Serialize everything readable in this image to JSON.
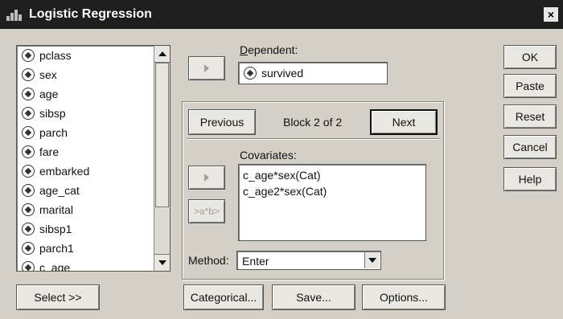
{
  "window": {
    "title": "Logistic Regression",
    "close_symbol": "×"
  },
  "variables": [
    {
      "name": "pclass"
    },
    {
      "name": "sex"
    },
    {
      "name": "age"
    },
    {
      "name": "sibsp"
    },
    {
      "name": "parch"
    },
    {
      "name": "fare"
    },
    {
      "name": "embarked"
    },
    {
      "name": "age_cat"
    },
    {
      "name": "marital"
    },
    {
      "name": "sibsp1"
    },
    {
      "name": "parch1"
    },
    {
      "name": "c_age"
    }
  ],
  "dependent": {
    "label": "Dependent:",
    "value": "survived"
  },
  "block": {
    "previous_label": "Previous",
    "status": "Block 2 of 2",
    "next_label": "Next"
  },
  "covariates": {
    "label": "Covariates:",
    "items": [
      "c_age*sex(Cat)",
      "c_age2*sex(Cat)"
    ]
  },
  "interaction_button": {
    "label": ">a*b>"
  },
  "method": {
    "label": "Method:",
    "value": "Enter"
  },
  "right_buttons": {
    "ok": "OK",
    "paste": "Paste",
    "reset": "Reset",
    "cancel": "Cancel",
    "help": "Help"
  },
  "bottom_buttons": {
    "select": "Select >>",
    "categorical": "Categorical...",
    "save": "Save...",
    "options": "Options..."
  },
  "colors": {
    "titlebar": "#1e1e1e",
    "face": "#d4d0c8"
  },
  "icons": {
    "variable": "scale-variable-icon",
    "move": "move-right-arrow-icon"
  }
}
